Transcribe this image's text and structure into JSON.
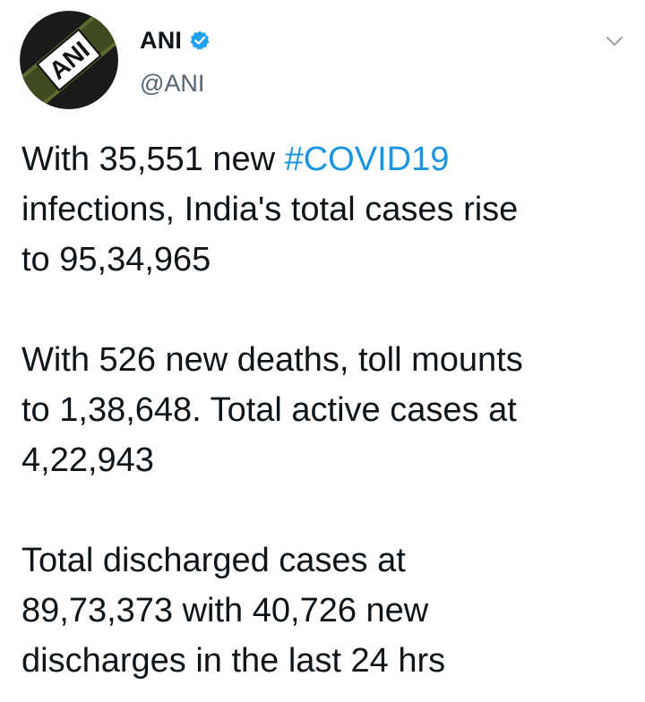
{
  "tweet": {
    "author": {
      "display_name": "ANI",
      "handle": "@ANI",
      "avatar_text": "ANI",
      "verified": true
    },
    "paragraphs": [
      {
        "lines": [
          [
            {
              "text": "With 35,551 new "
            },
            {
              "text": "#COVID19",
              "hashtag": true
            }
          ],
          [
            {
              "text": "infections, India's total cases rise"
            }
          ],
          [
            {
              "text": "to 95,34,965"
            }
          ]
        ]
      },
      {
        "lines": [
          [
            {
              "text": "With 526 new deaths, toll mounts"
            }
          ],
          [
            {
              "text": "to 1,38,648. Total active cases at"
            }
          ],
          [
            {
              "text": "4,22,943"
            }
          ]
        ]
      },
      {
        "lines": [
          [
            {
              "text": "Total discharged cases at"
            }
          ],
          [
            {
              "text": "89,73,373 with 40,726 new"
            }
          ],
          [
            {
              "text": "discharges in the last 24 hrs"
            }
          ]
        ]
      }
    ]
  },
  "icons": {
    "verified": "verified-badge-icon",
    "menu": "chevron-down-icon"
  },
  "colors": {
    "hashtag": "#1b95e0",
    "verified": "#1da1f2",
    "handle": "#536471",
    "text": "#0f1419",
    "avatar_bg": "#1a1a1a",
    "avatar_band": "#5b6b2e"
  }
}
